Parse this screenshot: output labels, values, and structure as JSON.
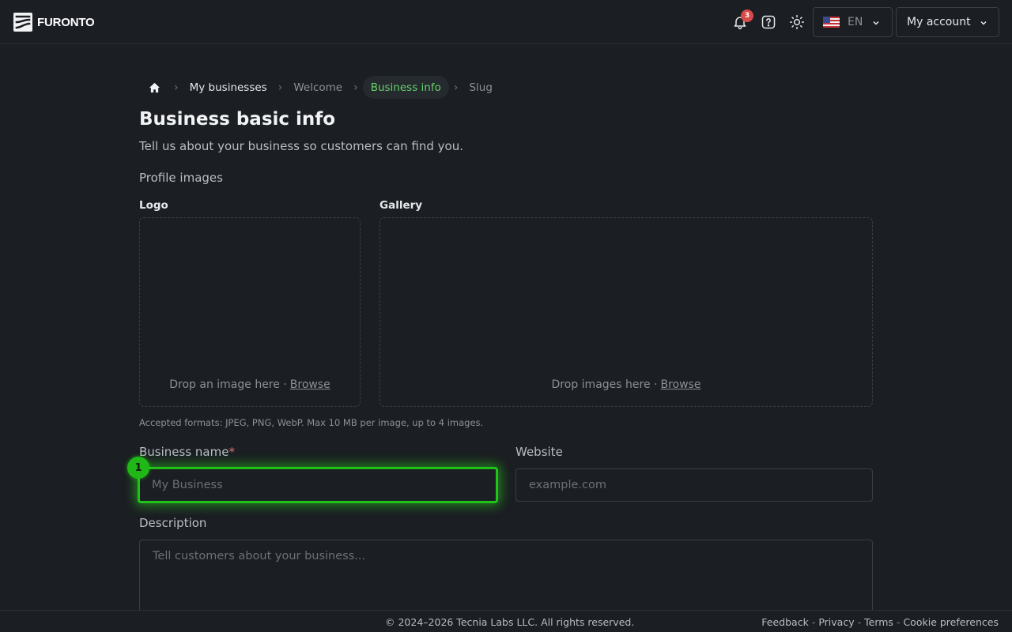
{
  "app": {
    "brand": "FURONTO",
    "accent_color": "#66d26a",
    "focus_color": "#21c21a"
  },
  "header": {
    "notifications": {
      "icon": "bell-icon",
      "count": "3"
    },
    "help_icon": "help-icon",
    "theme_icon": "sun-icon",
    "language": {
      "flag": "us-flag-icon",
      "label": "EN"
    },
    "account_label": "My account"
  },
  "breadcrumb": {
    "home_icon": "home-icon",
    "items": [
      {
        "label": "My businesses",
        "state": "link"
      },
      {
        "label": "Welcome",
        "state": "muted"
      },
      {
        "label": "Business info",
        "state": "active"
      },
      {
        "label": "Slug",
        "state": "muted"
      }
    ]
  },
  "page": {
    "title": "Business basic info",
    "subtitle": "Tell us about your business so customers can find you."
  },
  "profile_images": {
    "section_label": "Profile images",
    "logo": {
      "label": "Logo",
      "drop_text": "Drop an image here ·",
      "browse": "Browse"
    },
    "gallery": {
      "label": "Gallery",
      "drop_text": "Drop images here ·",
      "browse": "Browse"
    },
    "help": "Accepted formats: JPEG, PNG, WebP. Max 10 MB per image, up to 4 images."
  },
  "form": {
    "business_name": {
      "label": "Business name",
      "required_mark": "*",
      "value": "",
      "placeholder": "My Business",
      "marker": "1"
    },
    "website": {
      "label": "Website",
      "value": "",
      "placeholder": "example.com"
    },
    "description": {
      "label": "Description",
      "value": "",
      "placeholder": "Tell customers about your business..."
    }
  },
  "footer": {
    "copyright": "© 2024–2026 Tecnia Labs LLC. All rights reserved.",
    "links": [
      "Feedback",
      "Privacy",
      "Terms",
      "Cookie preferences"
    ],
    "separator": "-"
  }
}
